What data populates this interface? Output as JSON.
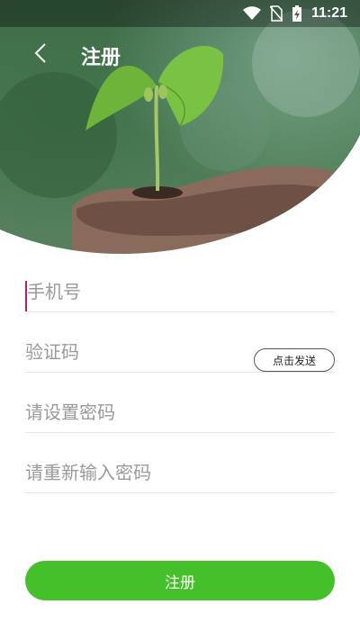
{
  "status_bar": {
    "time": "11:21",
    "icons": [
      "wifi-icon",
      "no-sim-icon",
      "battery-charging-icon"
    ]
  },
  "header": {
    "title": "注册",
    "back_icon": "chevron-left-icon"
  },
  "form": {
    "phone_placeholder": "手机号",
    "code_placeholder": "验证码",
    "send_code_label": "点击发送",
    "password_placeholder": "请设置密码",
    "confirm_password_placeholder": "请重新输入密码"
  },
  "submit_label": "注册",
  "colors": {
    "accent": "#45c02a",
    "cursor": "#b0226c",
    "divider": "#e6e6e6",
    "placeholder": "#9a9a9a"
  }
}
